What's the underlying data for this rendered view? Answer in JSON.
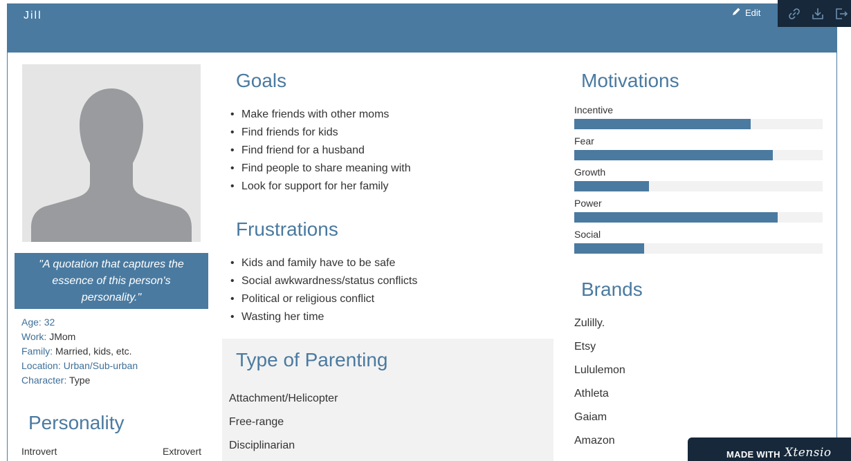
{
  "persona": {
    "name": "Jill",
    "edit_label": "Edit",
    "quote": "\"A quotation that captures the essence of this person's personality.\"",
    "facts": [
      {
        "label": "Age:",
        "value": "32"
      },
      {
        "label": "Work:",
        "value": "JMom"
      },
      {
        "label": "Family:",
        "value": "Married, kids, etc."
      },
      {
        "label": "Location:",
        "value": "Urban/Sub-urban"
      },
      {
        "label": "Character:",
        "value": "Type"
      }
    ]
  },
  "toolbar": {
    "icons": [
      "link-icon",
      "download-icon",
      "export-icon"
    ]
  },
  "personality": {
    "title": "Personality",
    "left_label": "Introvert",
    "right_label": "Extrovert"
  },
  "goals": {
    "title": "Goals",
    "items": [
      "Make friends with other moms",
      "Find friends for kids",
      "Find friend for a husband",
      "Find people to share meaning with",
      "Look for support for her family"
    ]
  },
  "frustrations": {
    "title": "Frustrations",
    "items": [
      "Kids and family have to be safe",
      "Social awkwardness/status conflicts",
      "Political or religious conflict",
      "Wasting her time"
    ]
  },
  "parenting": {
    "title": "Type of Parenting",
    "items": [
      "Attachment/Helicopter",
      "Free-range",
      "Disciplinarian"
    ]
  },
  "motivations": {
    "title": "Motivations",
    "items": [
      {
        "label": "Incentive",
        "level": 0.71
      },
      {
        "label": "Fear",
        "level": 0.8
      },
      {
        "label": "Growth",
        "level": 0.3
      },
      {
        "label": "Power",
        "level": 0.82
      },
      {
        "label": "Social",
        "level": 0.28
      }
    ]
  },
  "brands": {
    "title": "Brands",
    "items": [
      "Zulilly.",
      "Etsy",
      "Lululemon",
      "Athleta",
      "Gaiam",
      "Amazon"
    ]
  },
  "footer": {
    "made_with": "MADE WITH",
    "brand": "Xtensio"
  },
  "colors": {
    "accent": "#4a7aa0",
    "dark": "#16283a",
    "bar_track": "#f2f2f2"
  }
}
